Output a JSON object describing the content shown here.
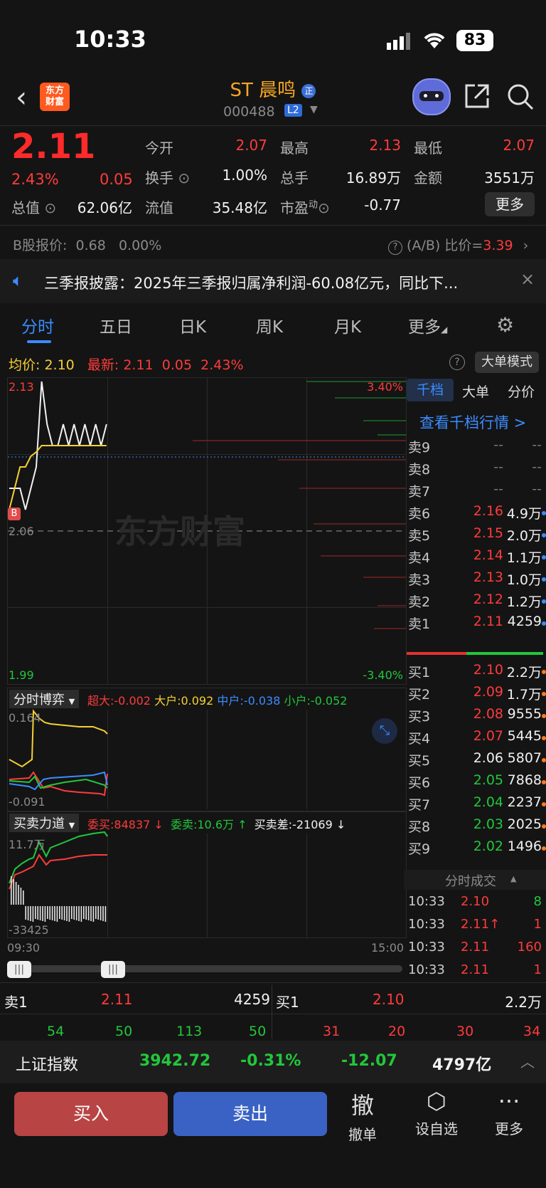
{
  "status_bar": {
    "time": "10:33",
    "battery": "83"
  },
  "header": {
    "logo": "东方\n财富",
    "name": "ST 晨鸣",
    "name_badge": "正",
    "code": "000488",
    "level_badge": "L2"
  },
  "quote": {
    "price": "2.11",
    "pct": "2.43%",
    "change": "0.05",
    "fields": [
      {
        "label": "今开",
        "value": "2.07"
      },
      {
        "label": "最高",
        "value": "2.13"
      },
      {
        "label": "最低",
        "value": "2.07"
      },
      {
        "label": "换手",
        "value": "1.00%"
      },
      {
        "label": "总手",
        "value": "16.89万"
      },
      {
        "label": "金额",
        "value": "3551万"
      },
      {
        "label": "总值",
        "value": "62.06亿"
      },
      {
        "label": "流值",
        "value": "35.48亿"
      },
      {
        "label": "市盈",
        "sup": "动",
        "value": "-0.77"
      }
    ],
    "more": "更多"
  },
  "b_share": {
    "label": "B股报价:",
    "price": "0.68",
    "pct": "0.00%",
    "ratio_label": "(A/B) 比价=",
    "ratio": "3.39"
  },
  "notice": "三季报披露：2025年三季报归属净利润-60.08亿元，同比下...",
  "tabs": [
    "分时",
    "五日",
    "日K",
    "周K",
    "月K",
    "更多"
  ],
  "chart_header": {
    "avg_label": "均价:",
    "avg": "2.10",
    "latest_label": "最新:",
    "latest": "2.11",
    "chg": "0.05",
    "pct": "2.43%",
    "mode": "大单模式"
  },
  "chart_data": {
    "type": "line",
    "y_top": "2.13",
    "y_mid": "2.06",
    "y_bottom": "1.99",
    "pct_top": "3.40%",
    "pct_bottom": "-3.40%",
    "x_start": "09:30",
    "x_end": "15:00",
    "marker": "B",
    "watermark": "东方财富",
    "series": [
      {
        "values": [
          2.08,
          2.08,
          2.08,
          2.07,
          2.08,
          2.09,
          2.13,
          2.11,
          2.1,
          2.1,
          2.11,
          2.1,
          2.11,
          2.1,
          2.11,
          2.1,
          2.11,
          2.1,
          2.11
        ]
      },
      {
        "values": [
          2.07,
          2.08,
          2.09,
          2.09,
          2.095,
          2.097,
          2.1,
          2.1,
          2.1,
          2.1,
          2.1,
          2.1,
          2.1,
          2.1,
          2.1,
          2.1,
          2.1,
          2.1,
          2.1
        ]
      }
    ]
  },
  "game_panel": {
    "title": "分时博弈",
    "items": [
      {
        "label": "超大:",
        "value": "-0.002"
      },
      {
        "label": "大户:",
        "value": "0.092"
      },
      {
        "label": "中户:",
        "value": "-0.038"
      },
      {
        "label": "小户:",
        "value": "-0.052"
      }
    ],
    "y_top": "0.164",
    "y_bottom": "-0.091"
  },
  "force_panel": {
    "title": "买卖力道",
    "buy_label": "委买:",
    "buy": "84837 ↓",
    "sell_label": "委卖:",
    "sell": "10.6万 ↑",
    "diff_label": "买卖差:",
    "diff": "-21069 ↓",
    "y_top": "11.7万",
    "y_bottom": "-33425"
  },
  "orderbook": {
    "tabs": [
      "千档",
      "大单",
      "分价"
    ],
    "link": "查看千档行情 >",
    "asks": [
      {
        "label": "卖9",
        "price": "--",
        "vol": "--"
      },
      {
        "label": "卖8",
        "price": "--",
        "vol": "--"
      },
      {
        "label": "卖7",
        "price": "--",
        "vol": "--"
      },
      {
        "label": "卖6",
        "price": "2.16",
        "vol": "4.9万"
      },
      {
        "label": "卖5",
        "price": "2.15",
        "vol": "2.0万"
      },
      {
        "label": "卖4",
        "price": "2.14",
        "vol": "1.1万"
      },
      {
        "label": "卖3",
        "price": "2.13",
        "vol": "1.0万"
      },
      {
        "label": "卖2",
        "price": "2.12",
        "vol": "1.2万"
      },
      {
        "label": "卖1",
        "price": "2.11",
        "vol": "4259"
      }
    ],
    "bids": [
      {
        "label": "买1",
        "price": "2.10",
        "vol": "2.2万"
      },
      {
        "label": "买2",
        "price": "2.09",
        "vol": "1.7万"
      },
      {
        "label": "买3",
        "price": "2.08",
        "vol": "9555"
      },
      {
        "label": "买4",
        "price": "2.07",
        "vol": "5445"
      },
      {
        "label": "买5",
        "price": "2.06",
        "vol": "5807"
      },
      {
        "label": "买6",
        "price": "2.05",
        "vol": "7868"
      },
      {
        "label": "买7",
        "price": "2.04",
        "vol": "2237"
      },
      {
        "label": "买8",
        "price": "2.03",
        "vol": "2025"
      },
      {
        "label": "买9",
        "price": "2.02",
        "vol": "1496"
      }
    ],
    "ticks_title": "分时成交",
    "ticks": [
      {
        "time": "10:33",
        "price": "2.10",
        "vol": "8"
      },
      {
        "time": "10:33",
        "price": "2.11↑",
        "vol": "1"
      },
      {
        "time": "10:33",
        "price": "2.11",
        "vol": "160"
      },
      {
        "time": "10:33",
        "price": "2.11",
        "vol": "1"
      }
    ]
  },
  "level1": {
    "sell_label": "卖1",
    "sell_price": "2.11",
    "sell_vol": "4259",
    "buy_label": "买1",
    "buy_price": "2.10",
    "buy_vol": "2.2万",
    "sell_queue": [
      "54",
      "50",
      "113",
      "50"
    ],
    "buy_queue": [
      "31",
      "20",
      "30",
      "34"
    ]
  },
  "index_bar": {
    "name": "上证指数",
    "value": "3942.72",
    "pct": "-0.31%",
    "chg": "-12.07",
    "amount": "4797亿"
  },
  "actions": {
    "buy": "买入",
    "sell": "卖出",
    "cancel_icon": "撤",
    "cancel": "撤单",
    "watch": "设自选",
    "more": "更多"
  }
}
